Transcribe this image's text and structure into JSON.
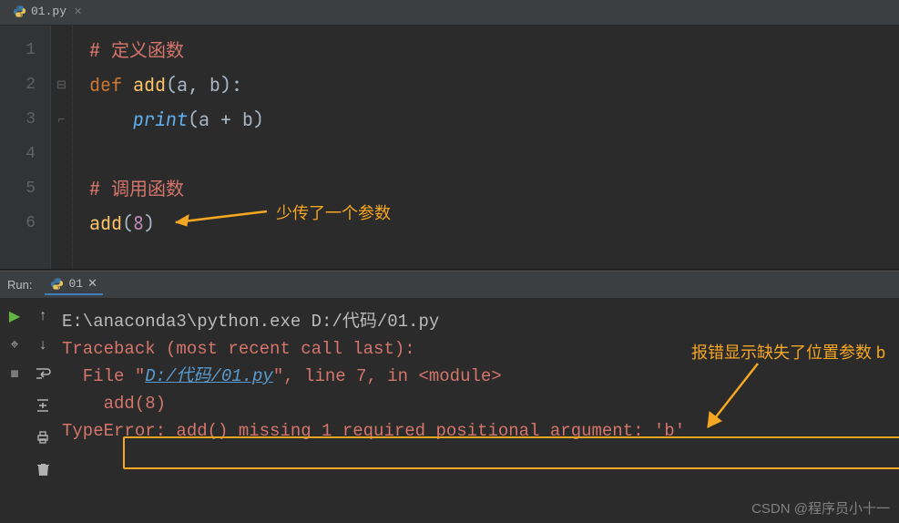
{
  "editor": {
    "tab": {
      "filename": "01.py"
    },
    "line_numbers": [
      "1",
      "2",
      "3",
      "4",
      "5",
      "6"
    ],
    "code": {
      "l1_comment": "# 定义函数",
      "l2_def": "def ",
      "l2_fname": "add",
      "l2_params": "(a, b):",
      "l3_builtin": "print",
      "l3_args": "(a + b)",
      "l5_comment": "# 调用函数",
      "l6_fname": "add",
      "l6_open": "(",
      "l6_num": "8",
      "l6_close": ")"
    },
    "annotation1": "少传了一个参数"
  },
  "run": {
    "label": "Run:",
    "tab_name": "01",
    "command": "E:\\anaconda3\\python.exe D:/代码/01.py",
    "traceback": "Traceback (most recent call last):",
    "file_prefix": "  File \"",
    "file_link": "D:/代码/01.py",
    "file_suffix": "\", line 7, in <module>",
    "call": "    add(8)",
    "error": "TypeError: add() missing 1 required positional argument: 'b'",
    "annotation2": "报错显示缺失了位置参数 b"
  },
  "watermark": "CSDN @程序员小十一"
}
